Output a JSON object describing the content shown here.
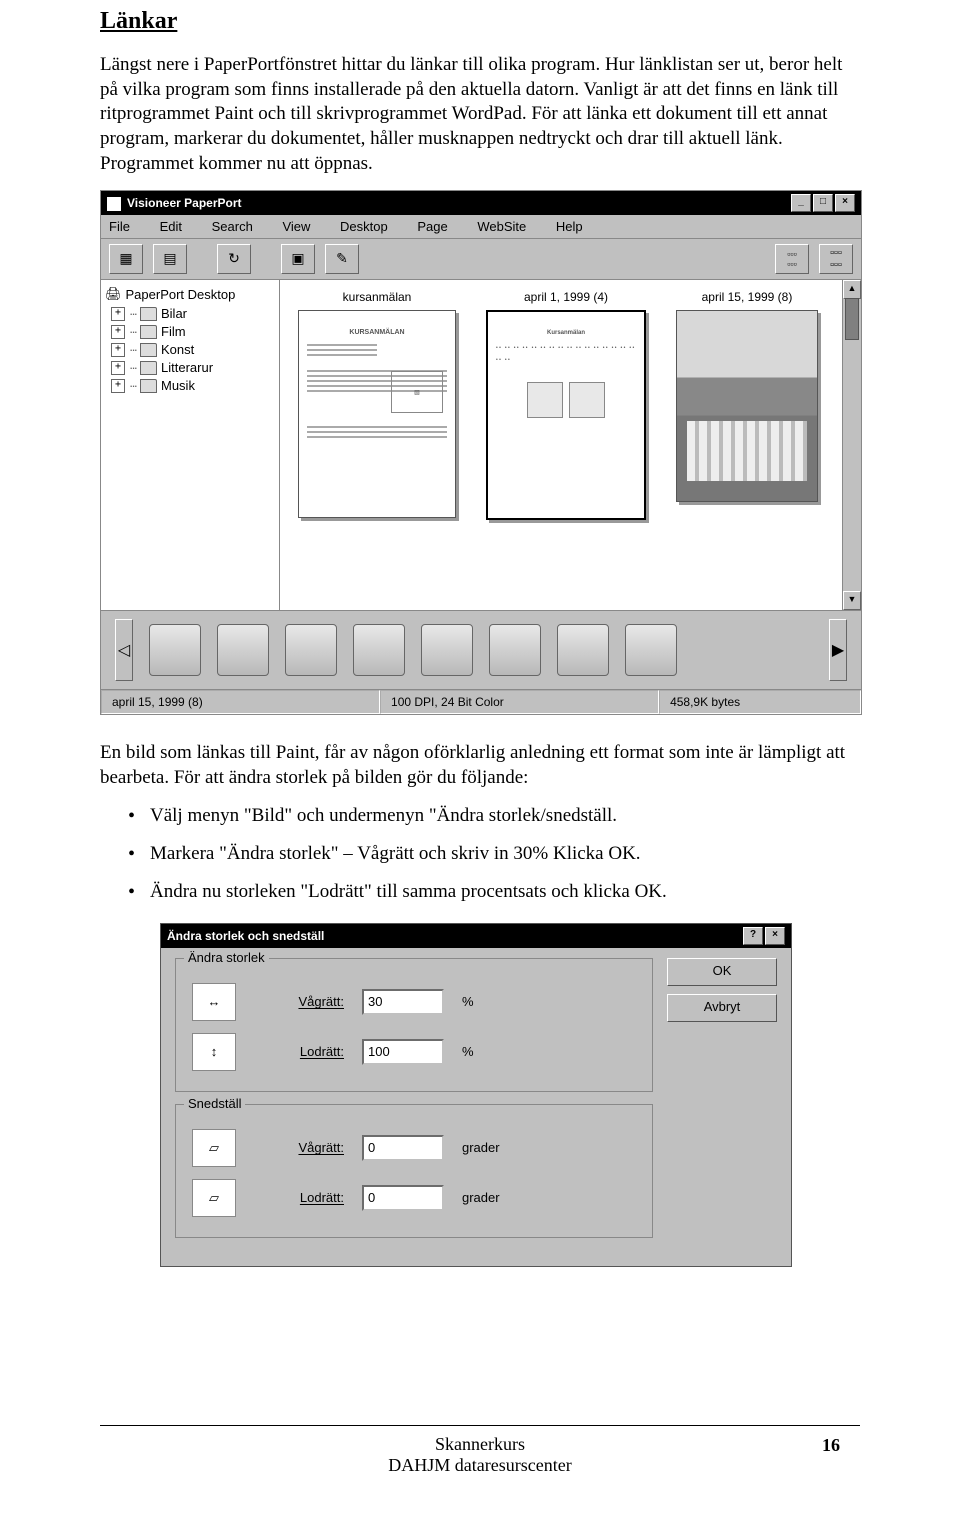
{
  "heading": "Länkar",
  "intro": "Längst nere i PaperPortfönstret hittar du länkar till olika program. Hur länklistan ser ut, beror helt på vilka program som finns installerade på den aktuella datorn. Vanligt är att det finns en länk till ritprogrammet Paint och till skrivprogrammet WordPad. För att länka ett dokument till ett annat program, markerar du dokumentet, håller musknappen nedtryckt och drar till aktuell länk. Programmet kommer nu att öppnas.",
  "app": {
    "title": "Visioneer PaperPort",
    "menus": [
      "File",
      "Edit",
      "Search",
      "View",
      "Desktop",
      "Page",
      "WebSite",
      "Help"
    ],
    "folders_root": "PaperPort Desktop",
    "folders": [
      "Bilar",
      "Film",
      "Konst",
      "Litterarur",
      "Musik"
    ],
    "thumbs": [
      {
        "label": "kursanmälan"
      },
      {
        "label": "april 1, 1999 (4)"
      },
      {
        "label": "april 15, 1999 (8)"
      }
    ],
    "status": {
      "left": "april 15, 1999 (8)",
      "mid": "100 DPI, 24 Bit Color",
      "right": "458,9K bytes"
    }
  },
  "after_shot": "En bild som länkas till Paint, får av någon oförklarlig anledning ett format som inte är lämpligt att bearbeta. För att ändra storlek på bilden gör du följande:",
  "bullets": [
    "Välj menyn \"Bild\" och undermenyn \"Ändra storlek/snedställ.",
    "Markera \"Ändra storlek\" – Vågrätt och skriv in 30% Klicka OK.",
    "Ändra nu storleken \"Lodrätt\" till samma procentsats och klicka OK."
  ],
  "dialog": {
    "title": "Ändra storlek och snedställ",
    "group1": "Ändra storlek",
    "group2": "Snedställ",
    "h_label": "Vågrätt:",
    "v_label": "Lodrätt:",
    "resize_h": "30",
    "resize_v": "100",
    "resize_unit": "%",
    "skew_h": "0",
    "skew_v": "0",
    "skew_unit": "grader",
    "ok": "OK",
    "cancel": "Avbryt"
  },
  "footer": {
    "l1": "Skannerkurs",
    "l2": "DAHJM dataresurscenter",
    "page": "16"
  }
}
